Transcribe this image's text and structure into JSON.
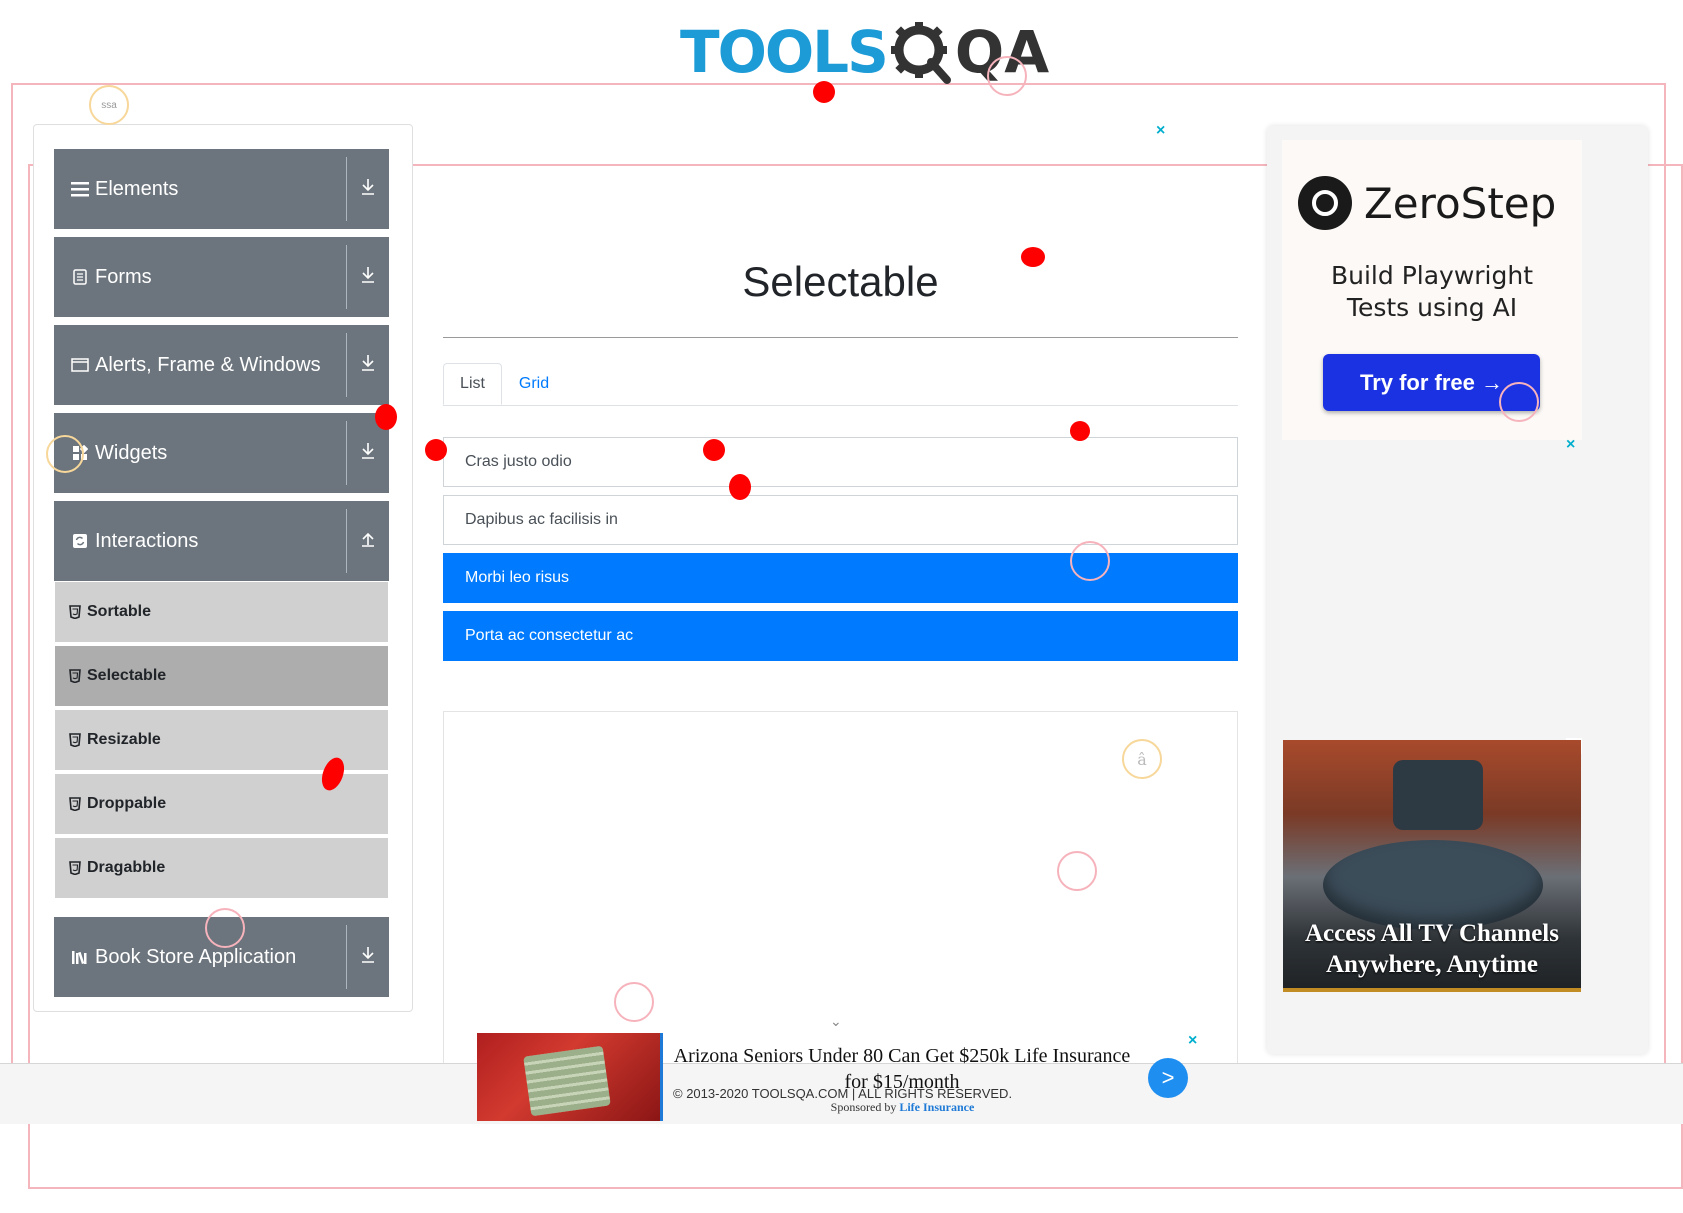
{
  "header": {
    "logo_text_left": "TOOLS",
    "logo_text_right": "QA"
  },
  "sidebar": {
    "groups": [
      {
        "label": "Elements",
        "icon": "hamburger-icon",
        "arrow": "download-icon"
      },
      {
        "label": "Forms",
        "icon": "document-icon",
        "arrow": "download-icon"
      },
      {
        "label": "Alerts, Frame & Windows",
        "icon": "window-icon",
        "arrow": "download-icon"
      },
      {
        "label": "Widgets",
        "icon": "widgets-icon",
        "arrow": "download-icon"
      },
      {
        "label": "Interactions",
        "icon": "sync-icon",
        "arrow": "upload-icon"
      },
      {
        "label": "Book Store Application",
        "icon": "books-icon",
        "arrow": "download-icon"
      }
    ],
    "interaction_items": [
      {
        "label": "Sortable",
        "active": false
      },
      {
        "label": "Selectable",
        "active": true
      },
      {
        "label": "Resizable",
        "active": false
      },
      {
        "label": "Droppable",
        "active": false
      },
      {
        "label": "Dragabble",
        "active": false
      }
    ]
  },
  "main": {
    "title": "Selectable",
    "tabs": [
      {
        "label": "List",
        "active": true
      },
      {
        "label": "Grid",
        "active": false
      }
    ],
    "list_items": [
      {
        "label": "Cras justo odio",
        "selected": false
      },
      {
        "label": "Dapibus ac facilisis in",
        "selected": false
      },
      {
        "label": "Morbi leo risus",
        "selected": true
      },
      {
        "label": "Porta ac consectetur ac",
        "selected": true
      }
    ],
    "stray_glyph": "â"
  },
  "ads": {
    "close_symbol": "×",
    "zerostep": {
      "brand": "ZeroStep",
      "tagline_line1": "Build Playwright",
      "tagline_line2": "Tests using AI",
      "button": "Try for free →"
    },
    "tv": {
      "line1": "Access All TV Channels",
      "line2": "Anywhere, Anytime"
    },
    "bottom": {
      "title": "Arizona Seniors Under 80 Can Get $250k Life Insurance for $15/month",
      "sponsored_prefix": "Sponsored by",
      "sponsor": "Life Insurance",
      "go": ">",
      "chevron": "⌄"
    },
    "corner_badge": "ssa"
  },
  "footer": {
    "text": "© 2013-2020 TOOLSQA.COM | ALL RIGHTS RESERVED."
  },
  "colors": {
    "sidebar_header": "#6c757d",
    "selected_item": "#007bff",
    "logo_blue": "#1d9bd7",
    "ad_close": "#00aecd"
  }
}
